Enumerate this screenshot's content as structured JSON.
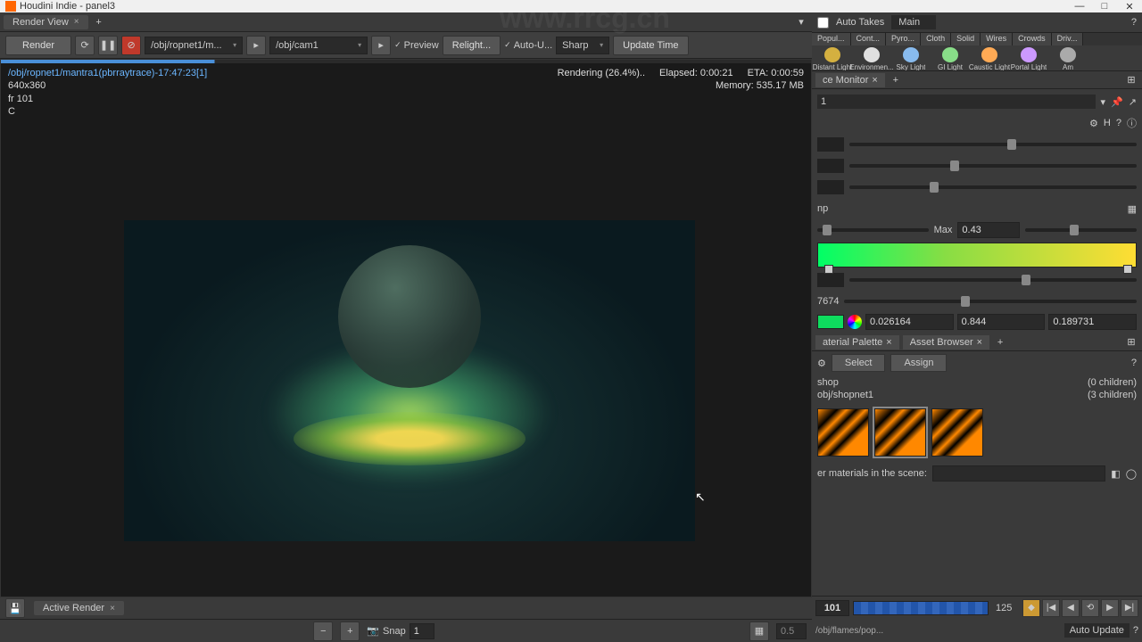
{
  "window": {
    "title": "Houdini Indie - panel3"
  },
  "watermark_url": "www.rrcg.cn",
  "tabs": {
    "render_view": "Render View"
  },
  "toolbar": {
    "render": "Render",
    "rop_path": "/obj/ropnet1/m...",
    "cam_path": "/obj/cam1",
    "preview": "Preview",
    "relight": "Relight...",
    "auto": "Auto-U...",
    "sharp": "Sharp",
    "update_time": "Update Time"
  },
  "render_status": {
    "path": "/obj/ropnet1/mantra1(pbrraytrace)-17:47:23[1]",
    "res": "640x360",
    "frame": "fr 101",
    "c": "C",
    "rendering": "Rendering (26.4%)..",
    "elapsed": "Elapsed: 0:00:21",
    "eta": "ETA: 0:00:59",
    "memory": "Memory:   535.17 MB"
  },
  "bottom": {
    "active_render": "Active Render",
    "snap": "Snap",
    "snap_n": "1",
    "opacity": "0.5"
  },
  "rtop": {
    "auto_takes": "Auto Takes",
    "main": "Main"
  },
  "shelf_tabs": [
    "Popul...",
    "Cont...",
    "Pyro...",
    "Cloth",
    "Solid",
    "Wires",
    "Crowds",
    "Driv..."
  ],
  "shelf_icons": [
    {
      "label": "Distant Light",
      "color": "#d4b040"
    },
    {
      "label": "Environmen...",
      "color": "#e0e0e0"
    },
    {
      "label": "Sky Light",
      "color": "#88bbee"
    },
    {
      "label": "GI Light",
      "color": "#88dd88"
    },
    {
      "label": "Caustic Light",
      "color": "#ffaa55"
    },
    {
      "label": "Portal Light",
      "color": "#cc99ff"
    },
    {
      "label": "Am",
      "color": "#aaaaaa"
    }
  ],
  "pane_tabs": {
    "monitor": "ce Monitor",
    "node": "1"
  },
  "params": {
    "label_np": "np",
    "max_label": "Max",
    "max_val": "0.43",
    "val_a": "7674",
    "color_r": "0.026164",
    "color_g": "0.844",
    "color_b": "0.189731"
  },
  "mat_tabs": {
    "palette": "aterial Palette",
    "asset": "Asset Browser"
  },
  "mat": {
    "select": "Select",
    "assign": "Assign",
    "shop": "shop",
    "shop_children": "(0 children)",
    "path": "obj/shopnet1",
    "path_children": "(3 children)",
    "filter_label": "er materials in the scene:"
  },
  "timeline": {
    "cur": "101",
    "end": "125",
    "path": "/obj/flames/pop...",
    "auto_update": "Auto Update"
  }
}
